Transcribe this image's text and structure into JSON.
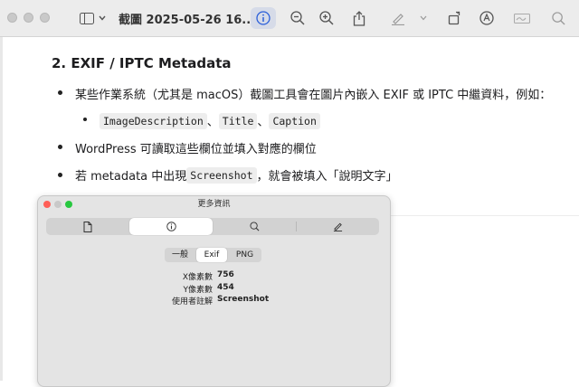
{
  "window": {
    "title": "截圖 2025-05-26 16...",
    "toolbar_icons": [
      "sidebar-icon",
      "chevron-down-icon",
      "info-icon",
      "zoom-out-icon",
      "zoom-in-icon",
      "share-icon",
      "highlight-icon",
      "chevron-down-icon",
      "rotate-icon",
      "markup-icon",
      "signature-icon",
      "search-icon"
    ]
  },
  "article": {
    "heading": "2. EXIF / IPTC Metadata",
    "bullet1": "某些作業系統（尤其是 macOS）截圖工具會在圖片內嵌入 EXIF 或 IPTC 中繼資料，例如：",
    "sub_codes": [
      "ImageDescription",
      "Title",
      "Caption"
    ],
    "sub_sep": "、",
    "bullet2": "WordPress 可讀取這些欄位並填入對應的欄位",
    "bullet3_pre": "若 metadata 中出現 ",
    "bullet3_code": "Screenshot",
    "bullet3_post": "，就會被填入「說明文字」"
  },
  "info_panel": {
    "title": "更多資訊",
    "sub_tabs": [
      "一般",
      "Exif",
      "PNG"
    ],
    "selected_sub_tab": "Exif",
    "rows": [
      {
        "key": "X像素數",
        "value": "756"
      },
      {
        "key": "Y像素數",
        "value": "454"
      },
      {
        "key": "使用者註解",
        "value": "Screenshot"
      }
    ]
  },
  "colors": {
    "close": "#ff5f57",
    "minimize": "#febc2e",
    "zoom": "#28c840",
    "accent": "#2b5fd9"
  }
}
